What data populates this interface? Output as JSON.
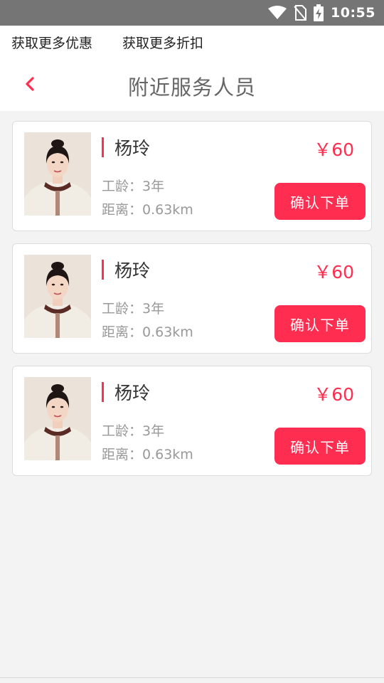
{
  "status_bar": {
    "time": "10:55",
    "icons": [
      "wifi-icon",
      "no-sim-icon",
      "battery-charging-icon"
    ]
  },
  "promo": {
    "link1": "获取更多优惠",
    "link2": "获取更多折扣"
  },
  "header": {
    "title": "附近服务人员",
    "back_icon": "chevron-left-icon"
  },
  "workers": [
    {
      "name": "杨玲",
      "price": "￥60",
      "experience": "工龄：3年",
      "distance": "距离：0.63km",
      "button": "确认下单"
    },
    {
      "name": "杨玲",
      "price": "￥60",
      "experience": "工龄：3年",
      "distance": "距离：0.63km",
      "button": "确认下单"
    },
    {
      "name": "杨玲",
      "price": "￥60",
      "experience": "工龄：3年",
      "distance": "距离：0.63km",
      "button": "确认下单"
    }
  ],
  "colors": {
    "accent": "#ff2d4f",
    "status_bar": "#757575",
    "background": "#f3f3f3"
  }
}
